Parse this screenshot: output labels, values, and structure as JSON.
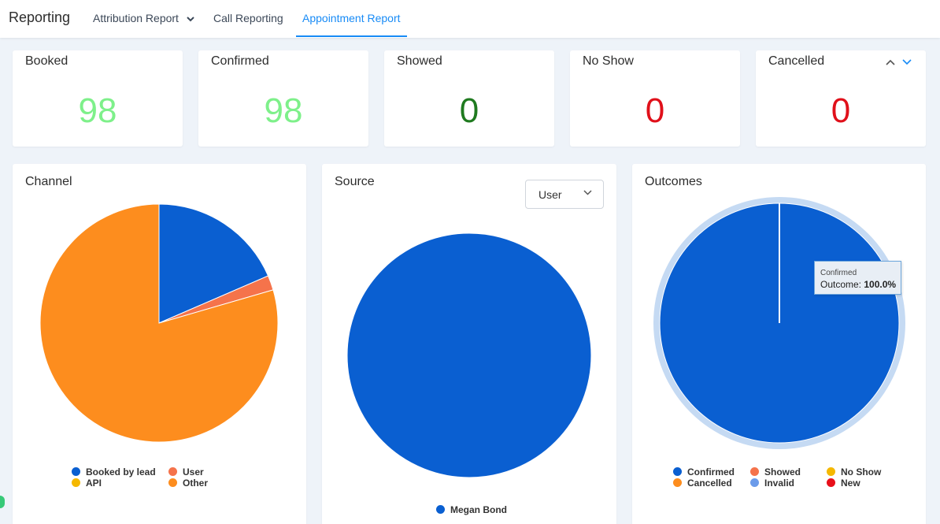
{
  "header": {
    "title": "Reporting",
    "tabs": [
      {
        "label": "Attribution Report"
      },
      {
        "label": "Call Reporting"
      },
      {
        "label": "Appointment Report"
      }
    ]
  },
  "stats": [
    {
      "label": "Booked",
      "value": "98",
      "color": "#7ef08a"
    },
    {
      "label": "Confirmed",
      "value": "98",
      "color": "#7ef08a"
    },
    {
      "label": "Showed",
      "value": "0",
      "color": "#1f7a1f"
    },
    {
      "label": "No Show",
      "value": "0",
      "color": "#e0101a"
    },
    {
      "label": "Cancelled",
      "value": "0",
      "color": "#e0101a"
    }
  ],
  "channel": {
    "title": "Channel",
    "legend": [
      "Booked by lead",
      "User",
      "API",
      "Other"
    ]
  },
  "source": {
    "title": "Source",
    "select_value": "User",
    "legend": [
      "Megan Bond"
    ]
  },
  "outcomes": {
    "title": "Outcomes",
    "legend": [
      "Confirmed",
      "Showed",
      "No Show",
      "Cancelled",
      "Invalid",
      "New"
    ],
    "tooltip": {
      "title": "Confirmed",
      "label": "Outcome:",
      "value": "100.0%"
    }
  },
  "chart_data": [
    {
      "type": "pie",
      "title": "Channel",
      "labels": [
        "Booked by lead",
        "User",
        "API",
        "Other"
      ],
      "values": [
        18.5,
        2,
        0,
        79.5
      ],
      "colors": [
        "#0a5fd1",
        "#f5734b",
        "#f5b800",
        "#fd8d1e"
      ]
    },
    {
      "type": "pie",
      "title": "Source",
      "labels": [
        "Megan Bond"
      ],
      "values": [
        100
      ],
      "colors": [
        "#0a5fd1"
      ]
    },
    {
      "type": "pie",
      "title": "Outcomes",
      "labels": [
        "Confirmed",
        "Showed",
        "No Show",
        "Cancelled",
        "Invalid",
        "New"
      ],
      "values": [
        100,
        0,
        0,
        0,
        0,
        0
      ],
      "colors": [
        "#0a5fd1",
        "#f5734b",
        "#f5b800",
        "#fd8d1e",
        "#6b9bea",
        "#e8101a"
      ]
    }
  ]
}
